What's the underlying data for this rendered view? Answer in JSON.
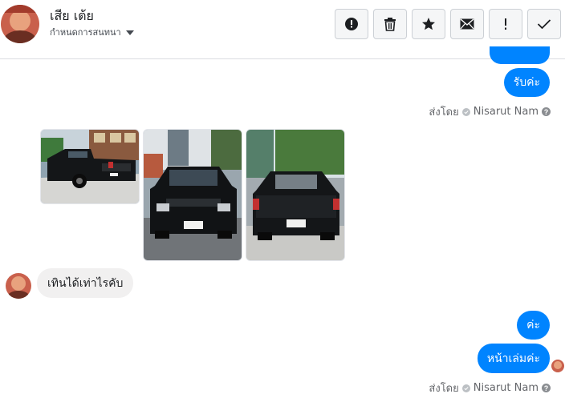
{
  "header": {
    "contact_name": "เสีย เต้ย",
    "settings_label": "กำหนดการสนทนา",
    "toolbar_icons": [
      "report-icon",
      "trash-icon",
      "star-icon",
      "mail-icon",
      "exclamation-icon",
      "check-icon"
    ]
  },
  "messages": {
    "out_1": "รับค่ะ",
    "sent_by_1": {
      "prefix": "ส่งโดย",
      "agent": "Nisarut Nam"
    },
    "in_1": "เทินได้เท่าไรคับ",
    "out_2": "ค่ะ",
    "out_3": "หน้าเล่มค่ะ",
    "sent_by_2": {
      "prefix": "ส่งโดย",
      "agent": "Nisarut Nam"
    }
  },
  "colors": {
    "outgoing_bubble": "#0084ff",
    "incoming_bubble": "#f1f0f0"
  }
}
